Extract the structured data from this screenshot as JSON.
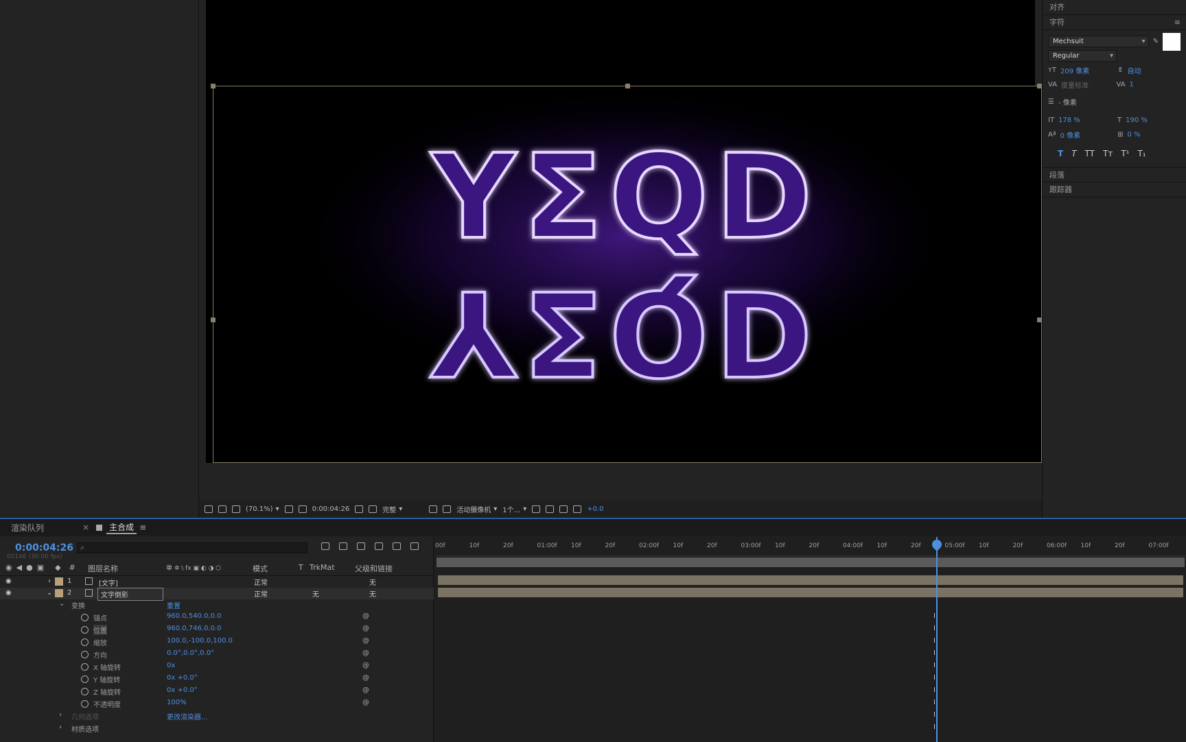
{
  "right_panel": {
    "align_header": "对齐",
    "char_header": "字符",
    "font": "Mechsuit",
    "style": "Regular",
    "size": "209 像素",
    "leading": "自动",
    "kerning": "度量标准",
    "tracking": "1",
    "stroke": "- 像素",
    "vscale": "178 %",
    "hscale": "190 %",
    "baseline": "0 像素",
    "tsume": "0 %",
    "paragraph_header": "段落",
    "tracker_header": "跟踪器",
    "style_buttons": [
      "T",
      "T",
      "TT",
      "Tт",
      "T¹",
      "T₁"
    ]
  },
  "viewer": {
    "zoom": "(70.1%)",
    "timecode": "0:00:04:26",
    "quality": "完整",
    "camera": "活动摄像机",
    "views": "1个...",
    "exposure": "+0.0",
    "artwork_line1": "YΣQD",
    "artwork_line2": "YΣQD"
  },
  "timeline": {
    "tab_render": "渲染队列",
    "tab_comp": "主合成",
    "timecode": "0:00:04:26",
    "timecode_sub": "00146 (30.00 fps)",
    "col_name": "图层名称",
    "col_mode": "模式",
    "col_t": "T",
    "col_trkmat": "TrkMat",
    "col_parent": "父级和链接",
    "layers": [
      {
        "num": "1",
        "name": "[文字]",
        "mode": "正常",
        "trkmat": "",
        "parent": "无"
      },
      {
        "num": "2",
        "name": "文字倒影",
        "mode": "正常",
        "trkmat": "无",
        "parent": "无"
      }
    ],
    "transform_label": "变换",
    "reset_label": "重置",
    "props": [
      {
        "name": "锚点",
        "value": "960.0,540.0,0.0"
      },
      {
        "name": "位置",
        "value": "960.0,746.0,0.0"
      },
      {
        "name": "缩放",
        "value": "100.0,-100.0,100.0"
      },
      {
        "name": "方向",
        "value": "0.0°,0.0°,0.0°"
      },
      {
        "name": "X 轴旋转",
        "value": "0x"
      },
      {
        "name": "Y 轴旋转",
        "value": "0x +0.0°"
      },
      {
        "name": "Z 轴旋转",
        "value": "0x +0.0°"
      },
      {
        "name": "不透明度",
        "value": "100%"
      }
    ],
    "geometry_label": "几何选项",
    "change_renderer": "更改渲染器...",
    "material_label": "材质选项",
    "ruler_ticks": [
      "00f",
      "10f",
      "20f",
      "01:00f",
      "10f",
      "20f",
      "02:00f",
      "10f",
      "20f",
      "03:00f",
      "10f",
      "20f",
      "04:00f",
      "10f",
      "20f",
      "05:00f",
      "10f",
      "20f",
      "06:00f",
      "10f",
      "20f",
      "07:00f"
    ]
  },
  "colors": {
    "accent": "#4e8fe0",
    "bar": "#7a7262",
    "glow": "#9b4dff"
  }
}
